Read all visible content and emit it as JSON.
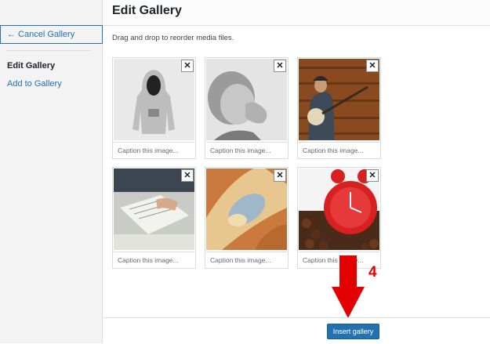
{
  "sidebar": {
    "cancel_label": "← Cancel Gallery",
    "items": [
      {
        "label": "Edit Gallery",
        "active": true
      },
      {
        "label": "Add to Gallery",
        "active": false
      }
    ]
  },
  "header": {
    "title": "Edit Gallery"
  },
  "main": {
    "instructions": "Drag and drop to reorder media files.",
    "images": [
      {
        "subject": "grey hoodie",
        "caption_placeholder": "Caption this image..."
      },
      {
        "subject": "child praying",
        "caption_placeholder": "Caption this image..."
      },
      {
        "subject": "banjo player",
        "caption_placeholder": "Caption this image..."
      },
      {
        "subject": "notebook on table",
        "caption_placeholder": "Caption this image..."
      },
      {
        "subject": "bread",
        "caption_placeholder": "Caption this image..."
      },
      {
        "subject": "alarm clock and coffee beans",
        "caption_placeholder": "Caption this image..."
      }
    ],
    "close_glyph": "✕"
  },
  "toolbar": {
    "insert_label": "Insert gallery"
  },
  "annotation": {
    "step": "4",
    "color": "#e20000"
  },
  "colors": {
    "accent": "#2271b1"
  }
}
